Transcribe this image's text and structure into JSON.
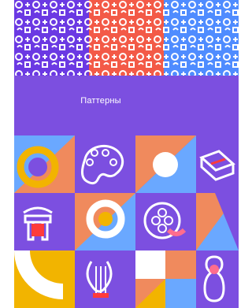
{
  "header": {
    "title": "Паттерны"
  },
  "palette": {
    "purple": "#7c4fe0",
    "orange": "#f08a5d",
    "yellow": "#f2b400",
    "blue": "#6aa8ff",
    "pink": "#ff6d8e",
    "white": "#ffffff",
    "red": "#ff3b3b"
  },
  "icons": {
    "top_patterns": [
      "pattern-purple",
      "pattern-red",
      "pattern-blue"
    ],
    "tiles": [
      "ring-tile",
      "palette-icon",
      "circle-tile",
      "book-icon",
      "column-capital-icon",
      "ring-and-shapes-tile",
      "film-reel-icon",
      "triangle-tile",
      "arc-tile",
      "lyre-icon",
      "blocks-tile",
      "matryoshka-icon"
    ]
  }
}
